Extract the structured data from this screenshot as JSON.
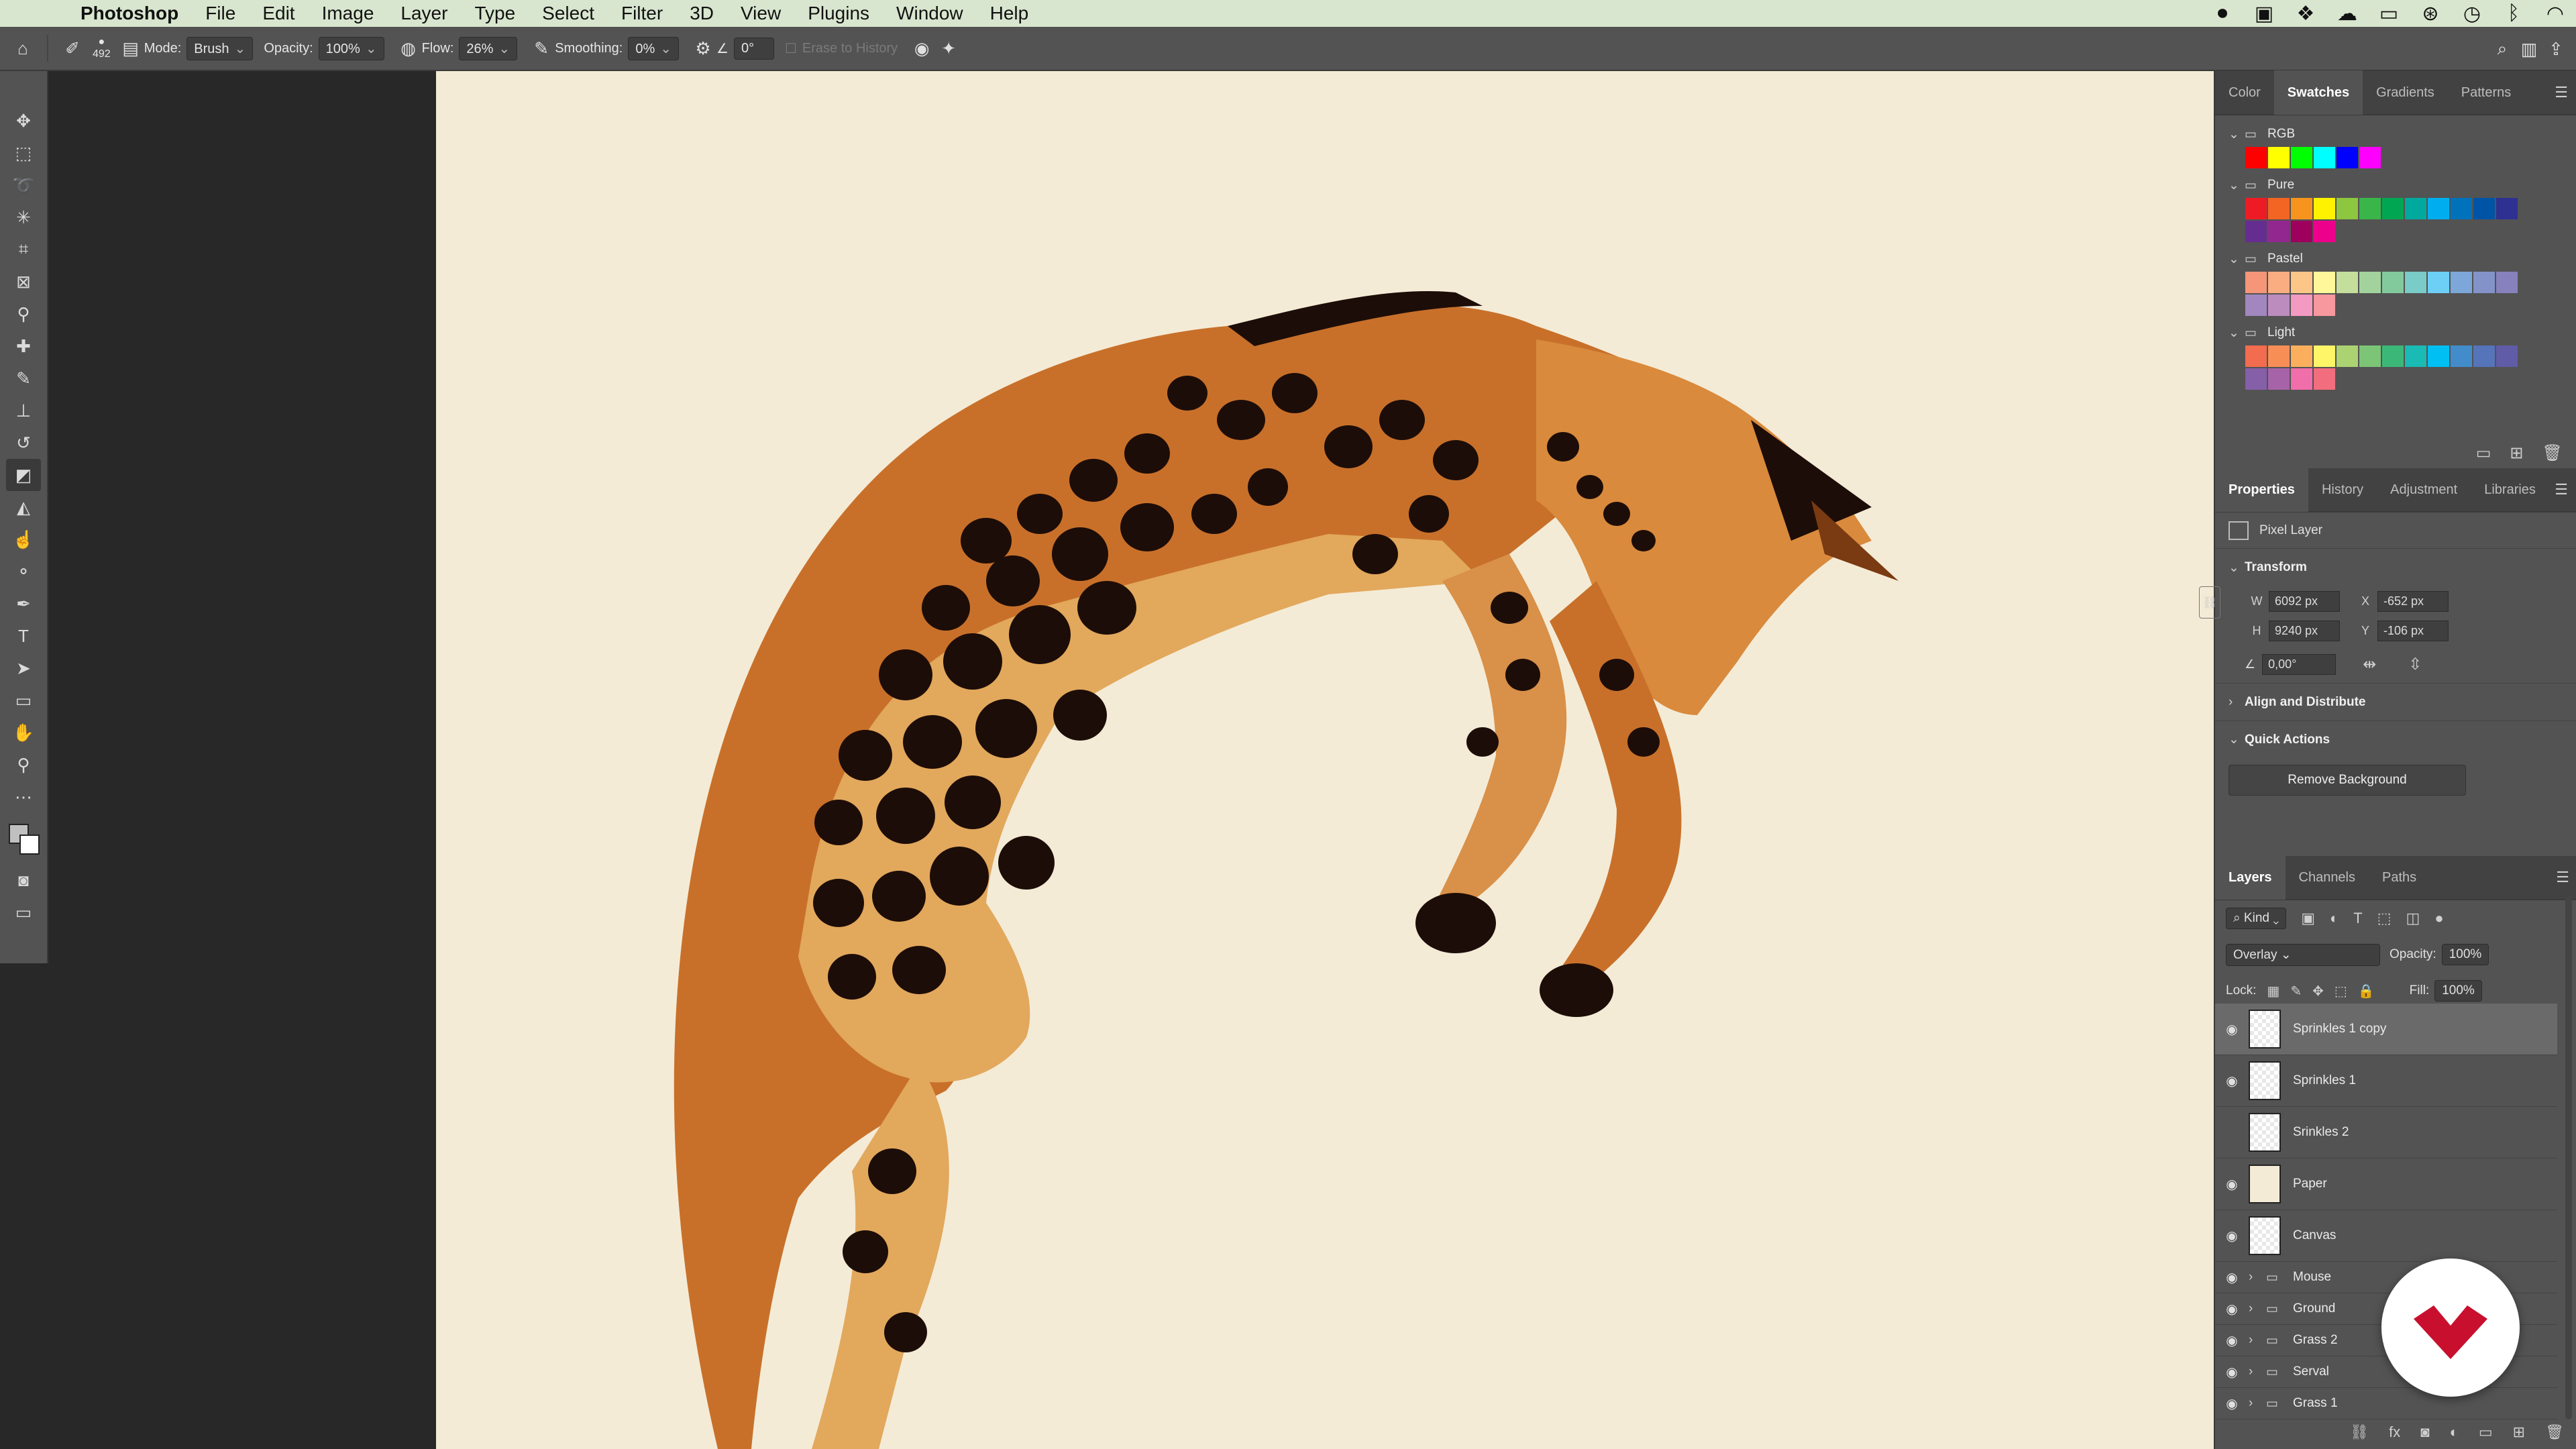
{
  "menubar": {
    "app": "Photoshop",
    "items": [
      "File",
      "Edit",
      "Image",
      "Layer",
      "Type",
      "Select",
      "Filter",
      "3D",
      "View",
      "Plugins",
      "Window",
      "Help"
    ],
    "status_icons": [
      "record-icon",
      "display-icon",
      "dropbox-icon",
      "creative-cloud-icon",
      "cast-icon",
      "vpn-icon",
      "time-machine-icon",
      "bluetooth-icon",
      "wifi-icon"
    ]
  },
  "options": {
    "brush_size": "492",
    "mode_label": "Mode:",
    "mode_value": "Brush",
    "opacity_label": "Opacity:",
    "opacity_value": "100%",
    "flow_label": "Flow:",
    "flow_value": "26%",
    "smoothing_label": "Smoothing:",
    "smoothing_value": "0%",
    "angle_value": "0°",
    "erase_history": "Erase to History"
  },
  "swatches_panel": {
    "tabs": [
      "Color",
      "Swatches",
      "Gradients",
      "Patterns"
    ],
    "active_tab": "Swatches",
    "groups": [
      {
        "name": "RGB",
        "colors": [
          "#ff0000",
          "#ffff00",
          "#00ff00",
          "#00ffff",
          "#0000ff",
          "#ff00ff"
        ]
      },
      {
        "name": "Pure",
        "colors": [
          "#ed1c24",
          "#f26522",
          "#f7941d",
          "#fff200",
          "#8dc63f",
          "#39b54a",
          "#00a651",
          "#00a99d",
          "#00aeef",
          "#0072bc",
          "#0054a6",
          "#2e3192",
          "#662d91",
          "#92278f",
          "#9e005d",
          "#ec008c"
        ]
      },
      {
        "name": "Pastel",
        "colors": [
          "#f69679",
          "#f9ad81",
          "#fdc689",
          "#fff799",
          "#c4df9b",
          "#a3d39c",
          "#82ca9c",
          "#7accc8",
          "#6dcff6",
          "#7da7d9",
          "#8393ca",
          "#8781bd",
          "#a187be",
          "#bc8cbf",
          "#f49ac2",
          "#f6989d"
        ]
      },
      {
        "name": "Light",
        "colors": [
          "#f26c4f",
          "#f68e56",
          "#fbaf5d",
          "#fff568",
          "#acd372",
          "#7cc576",
          "#3bb878",
          "#1abbb4",
          "#00bff3",
          "#438ccb",
          "#5574b9",
          "#605ca8",
          "#855fa8",
          "#a763a8",
          "#f06ea9",
          "#f26d7d"
        ]
      }
    ]
  },
  "properties_panel": {
    "tabs": [
      "Properties",
      "History",
      "Adjustment",
      "Libraries"
    ],
    "active_tab": "Properties",
    "layer_type": "Pixel Layer",
    "transform_label": "Transform",
    "w_label": "W",
    "w_value": "6092 px",
    "h_label": "H",
    "h_value": "9240 px",
    "x_label": "X",
    "x_value": "-652 px",
    "y_label": "Y",
    "y_value": "-106 px",
    "angle_value": "0,00°",
    "align_label": "Align and Distribute",
    "quick_actions_label": "Quick Actions",
    "remove_bg_label": "Remove Background"
  },
  "layers_panel": {
    "tabs": [
      "Layers",
      "Channels",
      "Paths"
    ],
    "active_tab": "Layers",
    "filter_kind": "Kind",
    "blend_mode": "Overlay",
    "opacity_label": "Opacity:",
    "opacity_value": "100%",
    "lock_label": "Lock:",
    "fill_label": "Fill:",
    "fill_value": "100%",
    "layers": [
      {
        "name": "Sprinkles 1 copy",
        "visible": true,
        "selected": true,
        "type": "pixel"
      },
      {
        "name": "Sprinkles 1",
        "visible": true,
        "selected": false,
        "type": "pixel"
      },
      {
        "name": "Srinkles 2",
        "visible": false,
        "selected": false,
        "type": "pixel"
      },
      {
        "name": "Paper",
        "visible": true,
        "selected": false,
        "type": "paper"
      },
      {
        "name": "Canvas",
        "visible": true,
        "selected": false,
        "type": "pixel"
      },
      {
        "name": "Mouse",
        "visible": true,
        "selected": false,
        "type": "group"
      },
      {
        "name": "Ground",
        "visible": true,
        "selected": false,
        "type": "group"
      },
      {
        "name": "Grass 2",
        "visible": true,
        "selected": false,
        "type": "group"
      },
      {
        "name": "Serval",
        "visible": true,
        "selected": false,
        "type": "group"
      },
      {
        "name": "Grass 1",
        "visible": true,
        "selected": false,
        "type": "group"
      }
    ]
  },
  "colors": {
    "accent": "#d4a017",
    "serval_body": "#c8702a",
    "serval_light": "#e2a85c",
    "spot": "#1d0d08",
    "paper": "#f4ebd6",
    "badge_red": "#c8102e"
  }
}
